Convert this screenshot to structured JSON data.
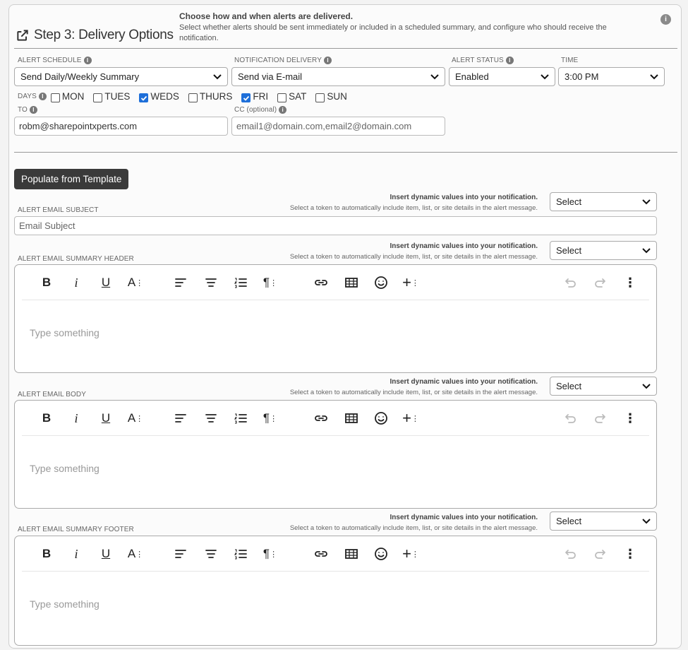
{
  "header": {
    "title": "Step 3: Delivery Options",
    "desc_strong": "Choose how and when alerts are delivered.",
    "desc_text": "Select whether alerts should be sent immediately or included in a scheduled summary, and configure who should receive the notification."
  },
  "schedule": {
    "alert_schedule_label": "ALERT SCHEDULE",
    "alert_schedule_value": "Send Daily/Weekly Summary",
    "delivery_label": "NOTIFICATION DELIVERY",
    "delivery_value": "Send via E-mail",
    "status_label": "ALERT STATUS",
    "status_value": "Enabled",
    "time_label": "TIME",
    "time_value": "3:00 PM"
  },
  "days": {
    "label": "DAYS",
    "items": [
      {
        "label": "MON",
        "checked": false
      },
      {
        "label": "TUES",
        "checked": false
      },
      {
        "label": "WEDS",
        "checked": true
      },
      {
        "label": "THURS",
        "checked": false
      },
      {
        "label": "FRI",
        "checked": true
      },
      {
        "label": "SAT",
        "checked": false
      },
      {
        "label": "SUN",
        "checked": false
      }
    ]
  },
  "recipients": {
    "to_label": "TO",
    "to_value": "robm@sharepointxperts.com",
    "cc_label": "CC (optional)",
    "cc_placeholder": "email1@domain.com,email2@domain.com"
  },
  "template_button": "Populate from Template",
  "token": {
    "strong": "Insert dynamic values into your notification.",
    "text": "Select a token to automatically include item, list, or site details in the alert message.",
    "select_value": "Select"
  },
  "subject": {
    "label": "ALERT EMAIL SUBJECT",
    "placeholder": "Email Subject"
  },
  "editors": {
    "summary_header_label": "ALERT EMAIL SUMMARY HEADER",
    "body_label": "ALERT EMAIL BODY",
    "summary_footer_label": "ALERT EMAIL SUMMARY FOOTER",
    "placeholder": "Type something"
  },
  "toolbar_icons": [
    "bold-icon",
    "italic-icon",
    "underline-icon",
    "font-size-icon",
    "align-left-icon",
    "align-center-icon",
    "ordered-list-icon",
    "paragraph-format-icon",
    "link-icon",
    "table-icon",
    "emoji-icon",
    "insert-more-icon",
    "undo-icon",
    "redo-icon",
    "more-options-icon"
  ],
  "colors": {
    "accent": "#1e6fd9",
    "dark_button": "#3a3a3a"
  }
}
